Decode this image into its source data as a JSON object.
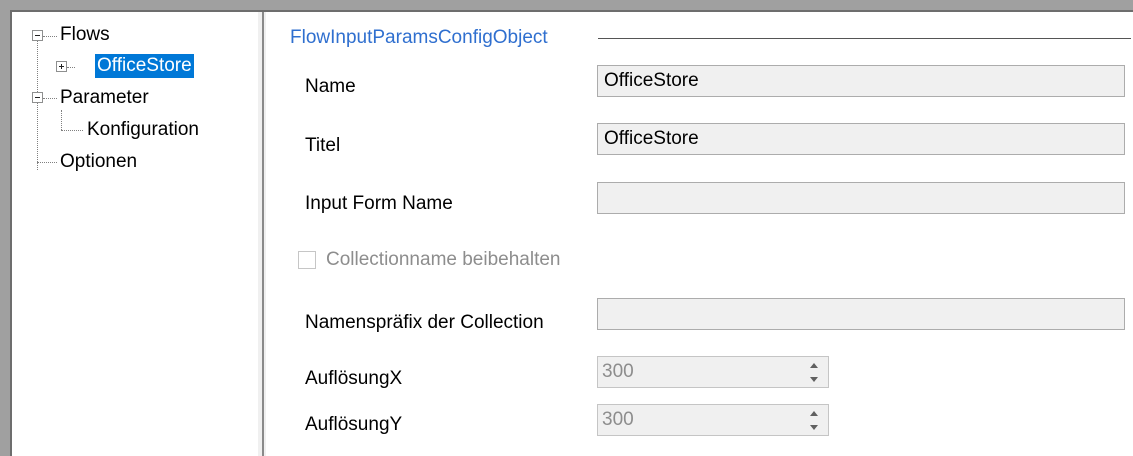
{
  "tree": {
    "items": [
      {
        "label": "Flows",
        "expander": "minus"
      },
      {
        "label": "OfficeStore",
        "expander": "plus",
        "selected": true
      },
      {
        "label": "Parameter",
        "expander": "minus"
      },
      {
        "label": "Konfiguration"
      },
      {
        "label": "Optionen"
      }
    ]
  },
  "group": {
    "title": "FlowInputParamsConfigObject"
  },
  "form": {
    "name_label": "Name",
    "name_value": "OfficeStore",
    "titel_label": "Titel",
    "titel_value": "OfficeStore",
    "input_form_name_label": "Input Form Name",
    "input_form_name_value": "",
    "collection_checkbox_label": "Collectionname beibehalten",
    "collection_checkbox_checked": false,
    "prefix_label": "Namenspräfix der Collection",
    "prefix_value": "",
    "resx_label": "AuflösungX",
    "resx_value": "300",
    "resy_label": "AuflösungY",
    "resy_value": "300"
  },
  "colors": {
    "selection": "#0078d7",
    "group_title": "#2f6fcf",
    "disabled_text": "#8d8d8d"
  }
}
